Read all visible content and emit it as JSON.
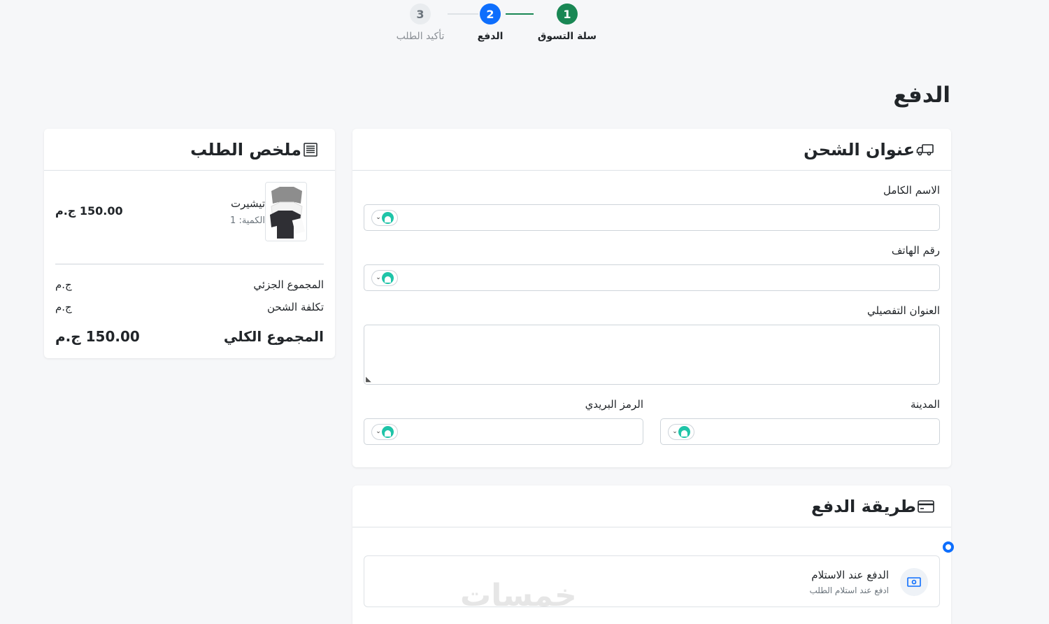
{
  "stepper": {
    "steps": [
      {
        "number": "1",
        "label": "سلة التسوق",
        "state": "done",
        "color": "#198754"
      },
      {
        "number": "2",
        "label": "الدفع",
        "state": "active",
        "color": "#0d6efd"
      },
      {
        "number": "3",
        "label": "تأكيد الطلب",
        "state": "pending",
        "color": "#e9ecef"
      }
    ]
  },
  "page": {
    "title": "الدفع"
  },
  "shipping": {
    "title": "عنوان الشحن",
    "icon": "truck-icon",
    "full_name_label": "الاسم الكامل",
    "full_name_value": "",
    "phone_label": "رقم الهاتف",
    "phone_value": "",
    "address_label": "العنوان التفصيلي",
    "address_value": "",
    "city_label": "المدينة",
    "city_value": "",
    "postal_label": "الرمز البريدي",
    "postal_value": ""
  },
  "payment": {
    "title": "طريقة الدفع",
    "icon": "credit-card-icon",
    "options": [
      {
        "title": "الدفع عند الاستلام",
        "subtitle": "ادفع عند استلام الطلب",
        "selected": true,
        "icon": "cash-icon"
      }
    ]
  },
  "summary": {
    "title": "ملخص الطلب",
    "icon": "receipt-icon",
    "item": {
      "name": "تيشيرت",
      "quantity_label": "الكمية: 1",
      "price": "150.00 ج.م"
    },
    "subtotal_label": "المجموع الجزئي",
    "subtotal_value": "ج.م",
    "shipping_label": "تكلفة الشحن",
    "shipping_value": "ج.م",
    "total_label": "المجموع الكلي",
    "total_value": "150.00 ج.م"
  },
  "watermark": "خمسات",
  "colors": {
    "accent": "#0d6efd",
    "success": "#198754",
    "widget": "#1fc4a8"
  }
}
